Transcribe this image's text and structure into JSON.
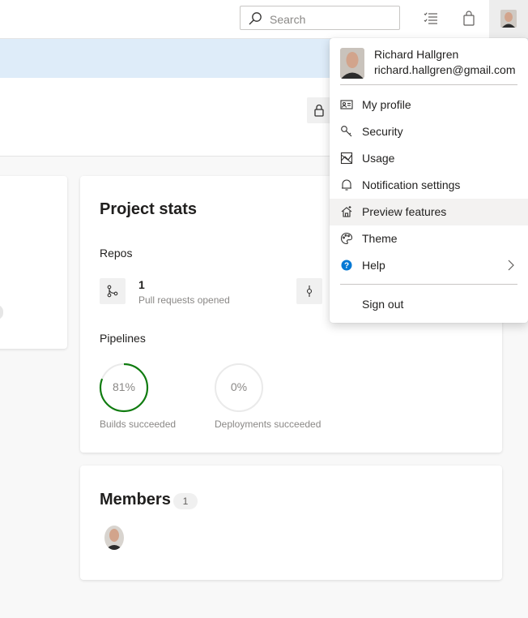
{
  "header": {
    "search_placeholder": "Search"
  },
  "stats": {
    "title": "Project stats",
    "repos_heading": "Repos",
    "pr_count": "1",
    "pr_label": "Pull requests opened",
    "pipelines_heading": "Pipelines",
    "builds_percent_text": "81%",
    "builds_fraction": 0.81,
    "builds_label": "Builds succeeded",
    "deploy_percent_text": "0%",
    "deploy_fraction": 0,
    "deploy_label": "Deployments succeeded"
  },
  "members": {
    "title": "Members",
    "count": "1"
  },
  "profile_menu": {
    "user_name": "Richard Hallgren",
    "user_email": "richard.hallgren@gmail.com",
    "items": [
      {
        "label": "My profile",
        "icon": "contact-card-icon"
      },
      {
        "label": "Security",
        "icon": "key-icon"
      },
      {
        "label": "Usage",
        "icon": "usage-icon"
      },
      {
        "label": "Notification settings",
        "icon": "bell-icon"
      },
      {
        "label": "Preview features",
        "icon": "preview-features-icon"
      },
      {
        "label": "Theme",
        "icon": "palette-icon"
      },
      {
        "label": "Help",
        "icon": "help-icon"
      }
    ],
    "sign_out": "Sign out"
  },
  "colors": {
    "accent": "#0078d4",
    "success": "#107c10",
    "banner": "#deecf9"
  }
}
